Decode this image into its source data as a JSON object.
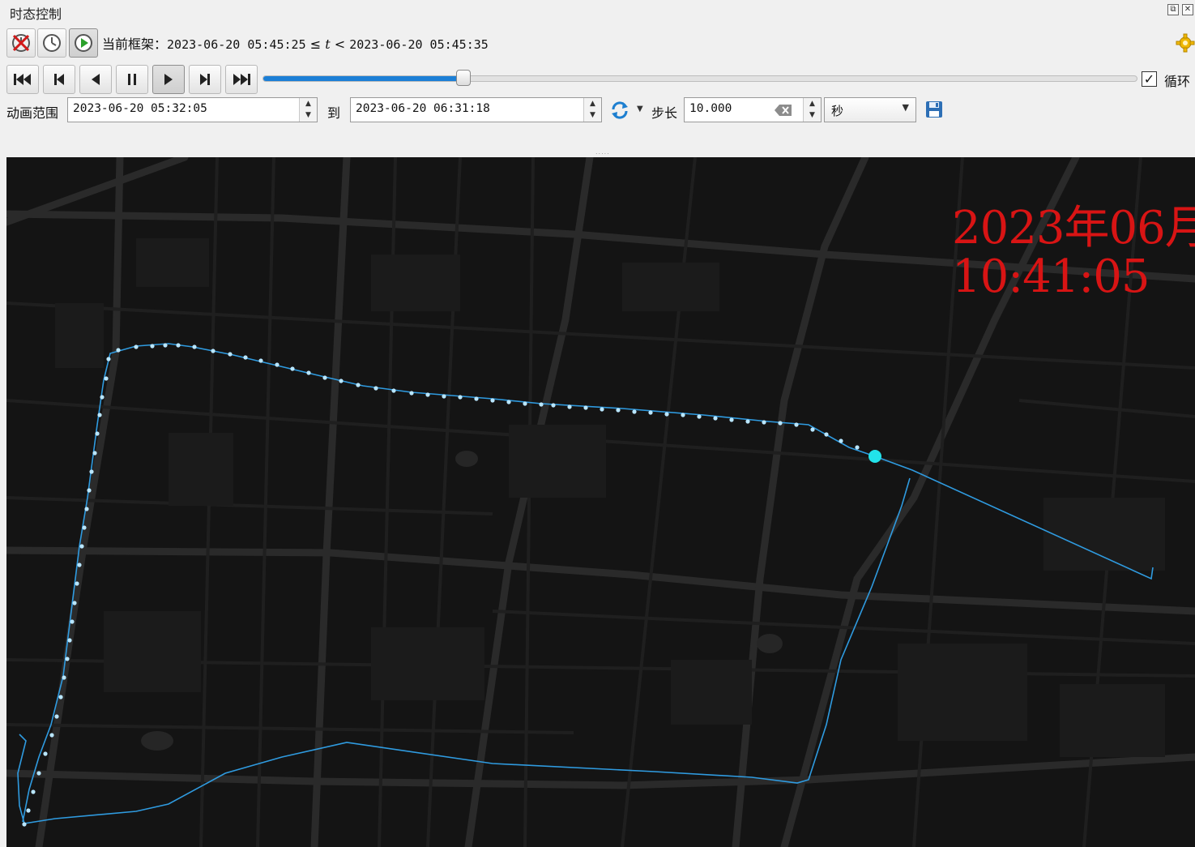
{
  "panel": {
    "title": "时态控制",
    "restore_icon": "restore-window-icon",
    "close_icon": "close-window-icon"
  },
  "modes": {
    "disable_icon": "temporal-disabled-icon",
    "fixed_range_icon": "clock-icon",
    "animated_icon": "play-circle-icon"
  },
  "current_frame": {
    "label": "当前框架：",
    "start": "2023-06-20 05:45:25",
    "op1": " ≤ ",
    "var": "t",
    "op2": " < ",
    "end": "2023-06-20 05:45:35"
  },
  "playback": {
    "buttons": [
      "rewind-to-start",
      "previous-frame",
      "play-backward",
      "pause",
      "play-forward",
      "next-frame",
      "skip-to-end"
    ],
    "progress": 0.23,
    "loop_checked": true,
    "loop_label": "循环"
  },
  "range": {
    "label": "动画范围",
    "start": "2023-06-20 05:32:05",
    "to_label": "到",
    "end": "2023-06-20 06:31:18",
    "step_label": "步长",
    "step_value": "10.000",
    "unit": "秒"
  },
  "map": {
    "time_overlay_line1": "2023年06月",
    "time_overlay_line2": "10:41:05",
    "track_color": "#2f9be0",
    "dot_color": "#b9e6ff",
    "current_point_color": "#22e3ea",
    "background_color": "#141414",
    "overlay_color": "#d81414"
  }
}
